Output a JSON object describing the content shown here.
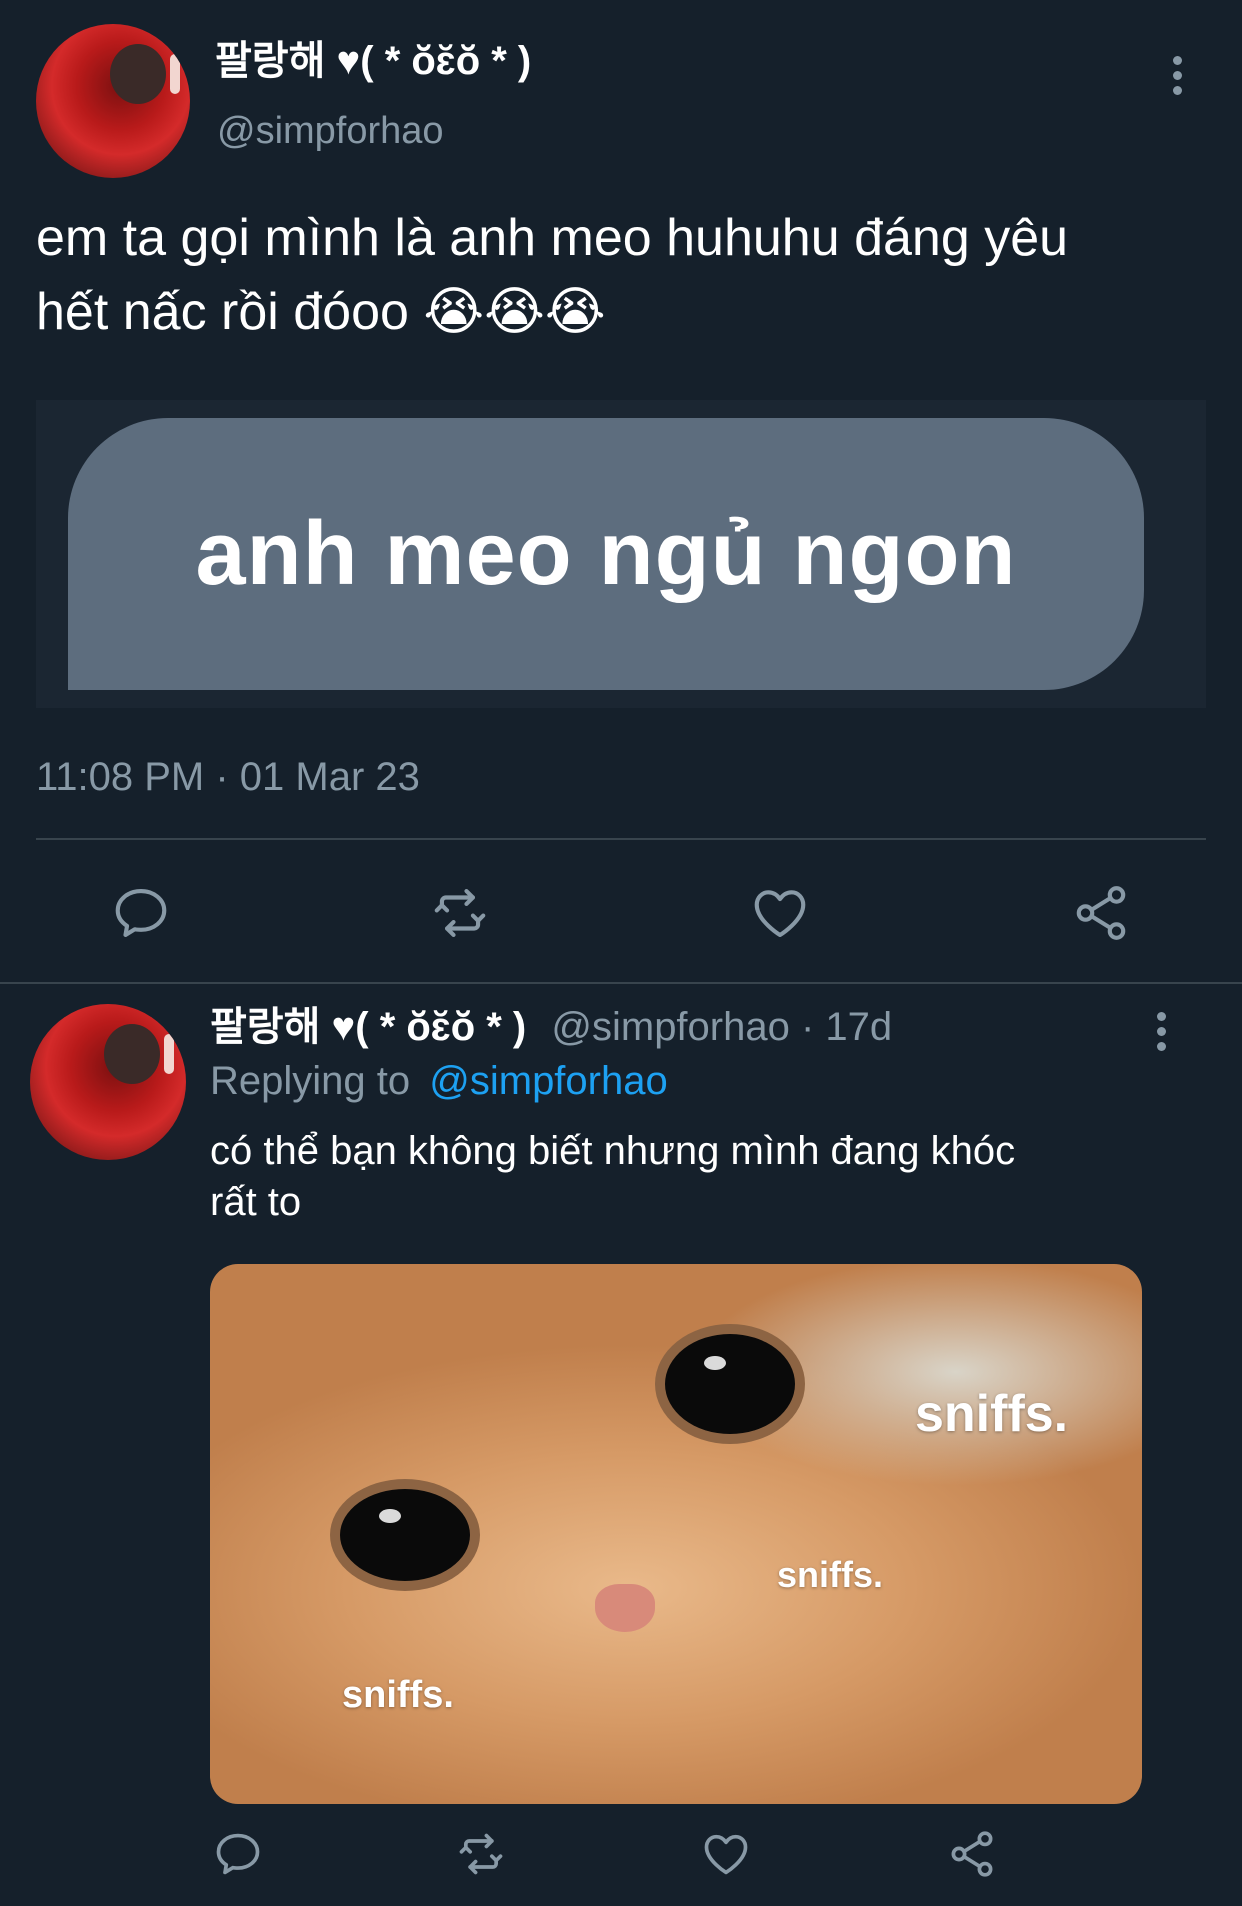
{
  "main_tweet": {
    "display_name": "팔랑해 ♥( * ŏ̆ɛ̆ŏ̆ * )",
    "handle": "@simpforhao",
    "text_line1": "em ta gọi mình là anh meo huhuhu đáng yêu",
    "text_line2": "hết nấc rồi đóoo 😭😭😭",
    "image_text": "anh meo ngủ ngon",
    "timestamp": "11:08 PM · 01 Mar 23",
    "icons": [
      "reply-icon",
      "retweet-icon",
      "like-icon",
      "share-icon"
    ]
  },
  "reply_tweet": {
    "display_name": "팔랑해 ♥( * ŏ̆ɛ̆ŏ̆ * )",
    "handle_time": "@simpforhao · 17d",
    "replying_prefix": "Replying to",
    "replying_handle": "@simpforhao",
    "text_line1": "có thể bạn không biết nhưng mình đang khóc",
    "text_line2": "rất to",
    "image_texts": [
      "sniffs.",
      "sniffs.",
      "sniffs."
    ],
    "icons": [
      "reply-icon",
      "retweet-icon",
      "like-icon",
      "share-icon"
    ]
  },
  "colors": {
    "background": "#15202b",
    "muted": "#8899a6",
    "link": "#1da1f2",
    "bubble": "#5d6d7e"
  }
}
